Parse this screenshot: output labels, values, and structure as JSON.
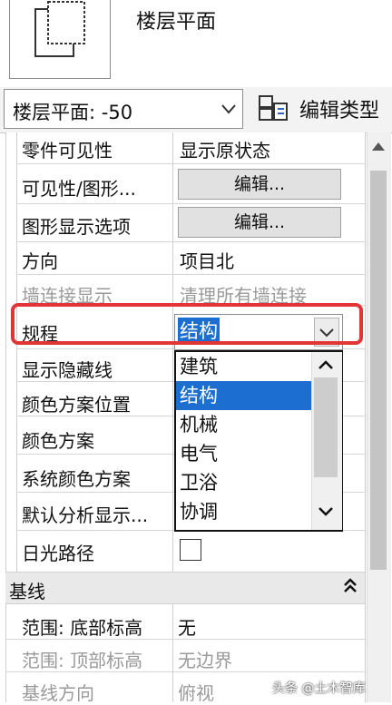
{
  "header": {
    "view_title": "楼层平面"
  },
  "type_selector": {
    "value": "楼层平面: -50",
    "edit_type_label": "编辑类型"
  },
  "properties": [
    {
      "label": "零件可见性",
      "value": "显示原状态",
      "kind": "text"
    },
    {
      "label": "可见性/图形...",
      "value": "编辑...",
      "kind": "button"
    },
    {
      "label": "图形显示选项",
      "value": "编辑...",
      "kind": "button"
    },
    {
      "label": "方向",
      "value": "项目北",
      "kind": "text"
    },
    {
      "label": "墙连接显示",
      "value": "清理所有墙连接",
      "kind": "text",
      "disabled": true
    },
    {
      "label": "规程",
      "value": "结构",
      "kind": "combo"
    },
    {
      "label": "显示隐藏线",
      "value": "",
      "kind": "text"
    },
    {
      "label": "颜色方案位置",
      "value": "",
      "kind": "text"
    },
    {
      "label": "颜色方案",
      "value": "",
      "kind": "text"
    },
    {
      "label": "系统颜色方案",
      "value": "",
      "kind": "text"
    },
    {
      "label": "默认分析显示...",
      "value": "",
      "kind": "text"
    },
    {
      "label": "日光路径",
      "value": "",
      "kind": "checkbox"
    }
  ],
  "discipline_dropdown": {
    "options": [
      "建筑",
      "结构",
      "机械",
      "电气",
      "卫浴",
      "协调"
    ],
    "selected": "结构"
  },
  "section": {
    "title": "基线",
    "collapse_glyph": "⌃"
  },
  "underlay": [
    {
      "label": "范围: 底部标高",
      "value": "无",
      "disabled": false
    },
    {
      "label": "范围: 顶部标高",
      "value": "无边界",
      "disabled": true
    },
    {
      "label": "基线方向",
      "value": "俯视",
      "disabled": true
    }
  ],
  "watermark": "头条 @土木智库",
  "colors": {
    "highlight": "#1c6fd1",
    "annotation_red": "#e23636"
  }
}
